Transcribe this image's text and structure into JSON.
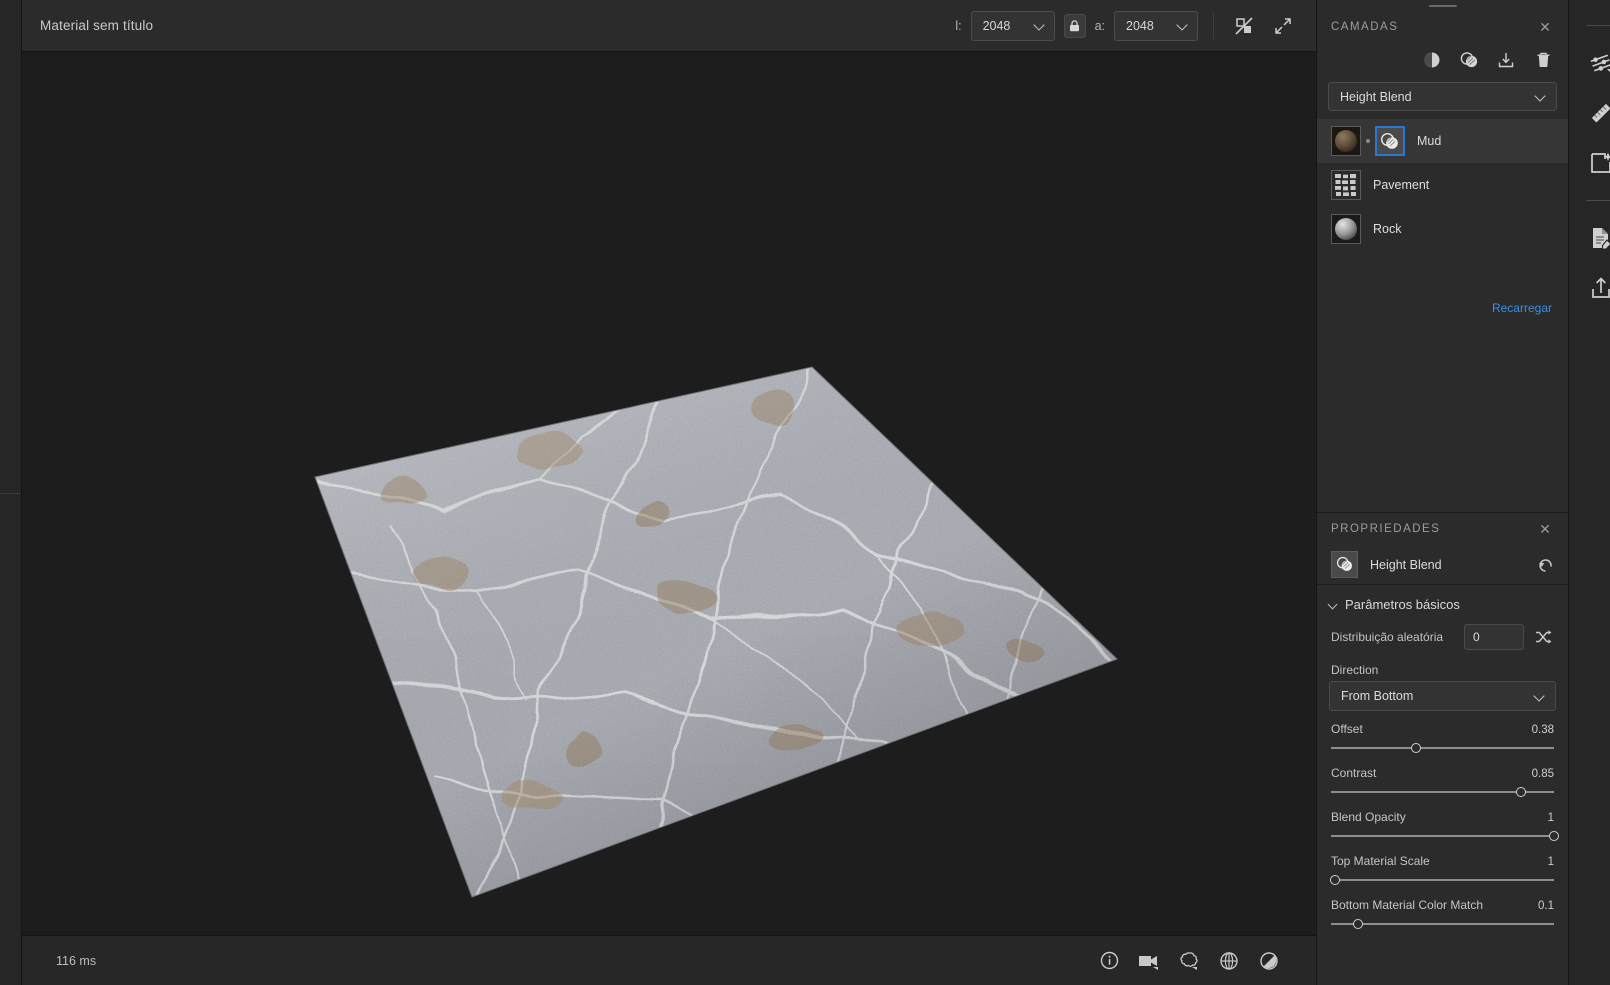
{
  "window": {
    "title": "Material sem título",
    "accent": "#2878d0",
    "link_color": "#3a8ee6"
  },
  "topbar": {
    "width_label": "l:",
    "width_value": "2048",
    "height_label": "a:",
    "height_value": "2048",
    "lock_icon": "lock-icon",
    "view_toggle_icon": "3d-2d-toggle-icon",
    "expand_icon": "expand-icon"
  },
  "viewport": {
    "status_time": "116 ms",
    "tools": [
      {
        "name": "info-icon",
        "label": "Info"
      },
      {
        "name": "camera-icon",
        "label": "Camera"
      },
      {
        "name": "environment-icon",
        "label": "Environment"
      },
      {
        "name": "grid-globe-icon",
        "label": "Grid"
      },
      {
        "name": "material-sphere-icon",
        "label": "Material"
      }
    ]
  },
  "layers_panel": {
    "title": "CAMADAS",
    "close_icon": "close-icon",
    "tools": [
      {
        "name": "contrast-icon",
        "label": "Adicionar ajuste"
      },
      {
        "name": "blend-icon",
        "label": "Adicionar mesclagem"
      },
      {
        "name": "import-icon",
        "label": "Importar"
      },
      {
        "name": "trash-icon",
        "label": "Excluir"
      }
    ],
    "blend_mode": "Height Blend",
    "layers": [
      {
        "name": "Mud",
        "selected": true,
        "has_blend": true,
        "thumb": "mud-sphere"
      },
      {
        "name": "Pavement",
        "selected": false,
        "has_blend": false,
        "thumb": "pavement-tiles"
      },
      {
        "name": "Rock",
        "selected": false,
        "has_blend": false,
        "thumb": "rock-sphere"
      }
    ],
    "reload_label": "Recarregar"
  },
  "properties_panel": {
    "title": "PROPRIEDADES",
    "close_icon": "close-icon",
    "node_name": "Height Blend",
    "node_icon": "blend-icon",
    "reset_icon": "reset-icon",
    "section_title": "Parâmetros básicos",
    "random_label": "Distribuição aleatória",
    "random_value": "0",
    "dice_icon": "shuffle-icon",
    "direction_label": "Direction",
    "direction_value": "From Bottom",
    "sliders": [
      {
        "label": "Offset",
        "value": "0.38",
        "pct": 38
      },
      {
        "label": "Contrast",
        "value": "0.85",
        "pct": 85
      },
      {
        "label": "Blend Opacity",
        "value": "1",
        "pct": 100
      },
      {
        "label": "Top Material Scale",
        "value": "1",
        "pct": 2
      },
      {
        "label": "Bottom Material Color Match",
        "value": "0.1",
        "pct": 12
      }
    ]
  },
  "far_rail": {
    "items": [
      {
        "name": "settings-sliders-icon",
        "label": "Parâmetros"
      },
      {
        "name": "ruler-icon",
        "label": "Medida"
      },
      {
        "name": "image-magic-icon",
        "label": "Imagem"
      },
      {
        "name": "document-edit-icon",
        "label": "Documento"
      },
      {
        "name": "export-icon",
        "label": "Exportar"
      }
    ]
  }
}
